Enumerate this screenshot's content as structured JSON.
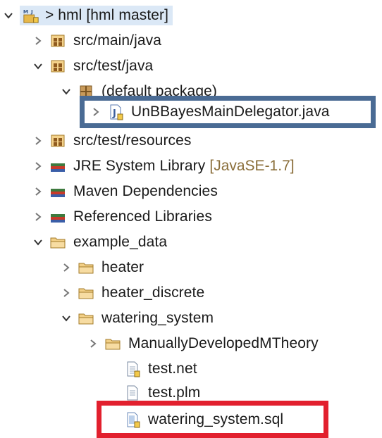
{
  "tree": {
    "root": {
      "prefix": ">",
      "label": "hml [hml master]"
    },
    "items": [
      {
        "label": "src/main/java"
      },
      {
        "label": "src/test/java"
      },
      {
        "label": "(default package)"
      },
      {
        "label": "UnBBayesMainDelegator.java"
      },
      {
        "label": "src/test/resources"
      },
      {
        "label": "JRE System Library",
        "decoration": "[JavaSE-1.7]"
      },
      {
        "label": "Maven Dependencies"
      },
      {
        "label": "Referenced Libraries"
      },
      {
        "label": "example_data"
      },
      {
        "label": "heater"
      },
      {
        "label": "heater_discrete"
      },
      {
        "label": "watering_system"
      },
      {
        "label": "ManuallyDevelopedMTheory"
      },
      {
        "label": "test.net"
      },
      {
        "label": "test.plm"
      },
      {
        "label": "watering_system.sql"
      }
    ]
  },
  "colors": {
    "selection_bg": "#dbe8f6",
    "highlight_blue": "#4a6b94",
    "highlight_red": "#e2202e",
    "decoration_text": "#8a6e3a"
  },
  "icons": {
    "expanded": "chevron-down-icon",
    "collapsed": "chevron-right-icon",
    "project": "maven-project-icon",
    "source_folder": "source-folder-icon",
    "package": "package-icon",
    "java_file": "java-file-icon",
    "library": "library-icon",
    "folder": "folder-icon",
    "file": "file-icon"
  }
}
